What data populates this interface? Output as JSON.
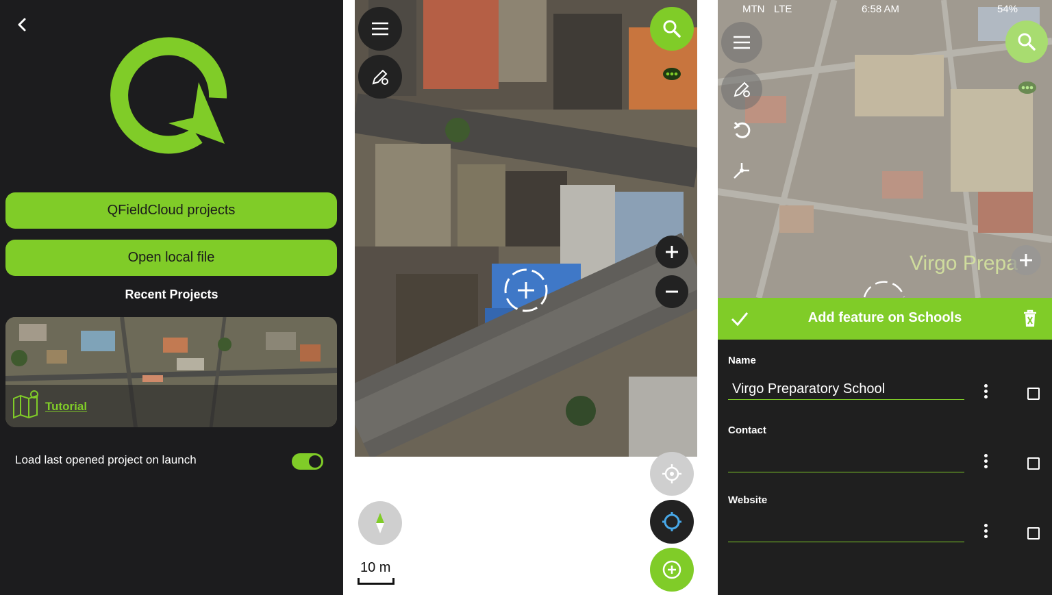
{
  "launcher": {
    "cloud_button": "QFieldCloud projects",
    "local_button": "Open local file",
    "recent_title": "Recent Projects",
    "recent_project_name": "Tutorial",
    "load_last_label": "Load last opened project on launch",
    "load_last_enabled": true,
    "accent": "#80cc28",
    "background": "#1c1c1e"
  },
  "map": {
    "scale_label": "10 m",
    "icons": [
      "menu-icon",
      "digitize-settings-icon",
      "search-icon",
      "more-icon",
      "zoom-in-icon",
      "zoom-out-icon",
      "crosshair-icon",
      "gps-icon",
      "locate-icon",
      "add-icon",
      "compass-icon"
    ]
  },
  "feature_form": {
    "status": {
      "carrier": "MTN",
      "network": "LTE",
      "time": "6:58 AM",
      "battery": "54%"
    },
    "map_label": "Virgo Prepa",
    "title": "Add feature on Schools",
    "fields": [
      {
        "label": "Name",
        "value": "Virgo Preparatory School"
      },
      {
        "label": "Contact",
        "value": ""
      },
      {
        "label": "Website",
        "value": ""
      }
    ]
  }
}
